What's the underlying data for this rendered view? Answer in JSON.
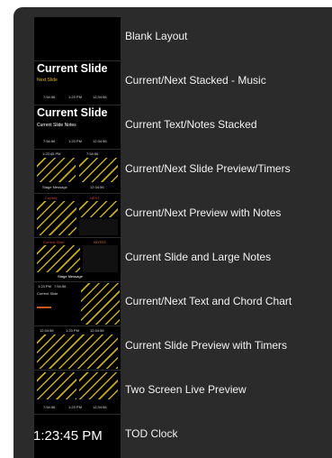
{
  "layouts": [
    {
      "label": "Blank Layout"
    },
    {
      "label": "Current/Next Stacked - Music",
      "thumb_title": "Current Slide",
      "thumb_sub": "Next Slide",
      "times": [
        "7:54:56",
        "1:23 PM",
        "12:34:56"
      ]
    },
    {
      "label": "Current Text/Notes Stacked",
      "thumb_title": "Current Slide",
      "thumb_sub": "Current Slide Notes",
      "times": [
        "7:54:56",
        "1:23 PM",
        "12:34:56"
      ]
    },
    {
      "label": "Current/Next Slide Preview/Timers",
      "thumb_top": [
        "1:23:45 PM",
        "7:54:56"
      ],
      "thumb_bottom": [
        "Stage Message",
        "12:34:56"
      ]
    },
    {
      "label": "Current/Next Preview with Notes",
      "thumb_top": [
        "Current",
        "NEXT"
      ]
    },
    {
      "label": "Current Slide and Large Notes",
      "thumb_top": [
        "Current Slide",
        "NOTES"
      ],
      "thumb_bottom": "Stage Message"
    },
    {
      "label": "Current/Next Text and Chord Chart",
      "thumb_top": [
        "1:23 PM",
        "7:54:56"
      ],
      "thumb_left": "Current Slide"
    },
    {
      "label": "Current Slide Preview with Timers",
      "thumb_top": [
        "12:34:56",
        "1:23 PM",
        "12:34:56"
      ]
    },
    {
      "label": "Two Screen Live Preview",
      "times": [
        "7:54:56",
        "1:23 PM",
        "12:34:56"
      ]
    },
    {
      "label": "TOD Clock",
      "clock": "1:23:45 PM"
    }
  ]
}
